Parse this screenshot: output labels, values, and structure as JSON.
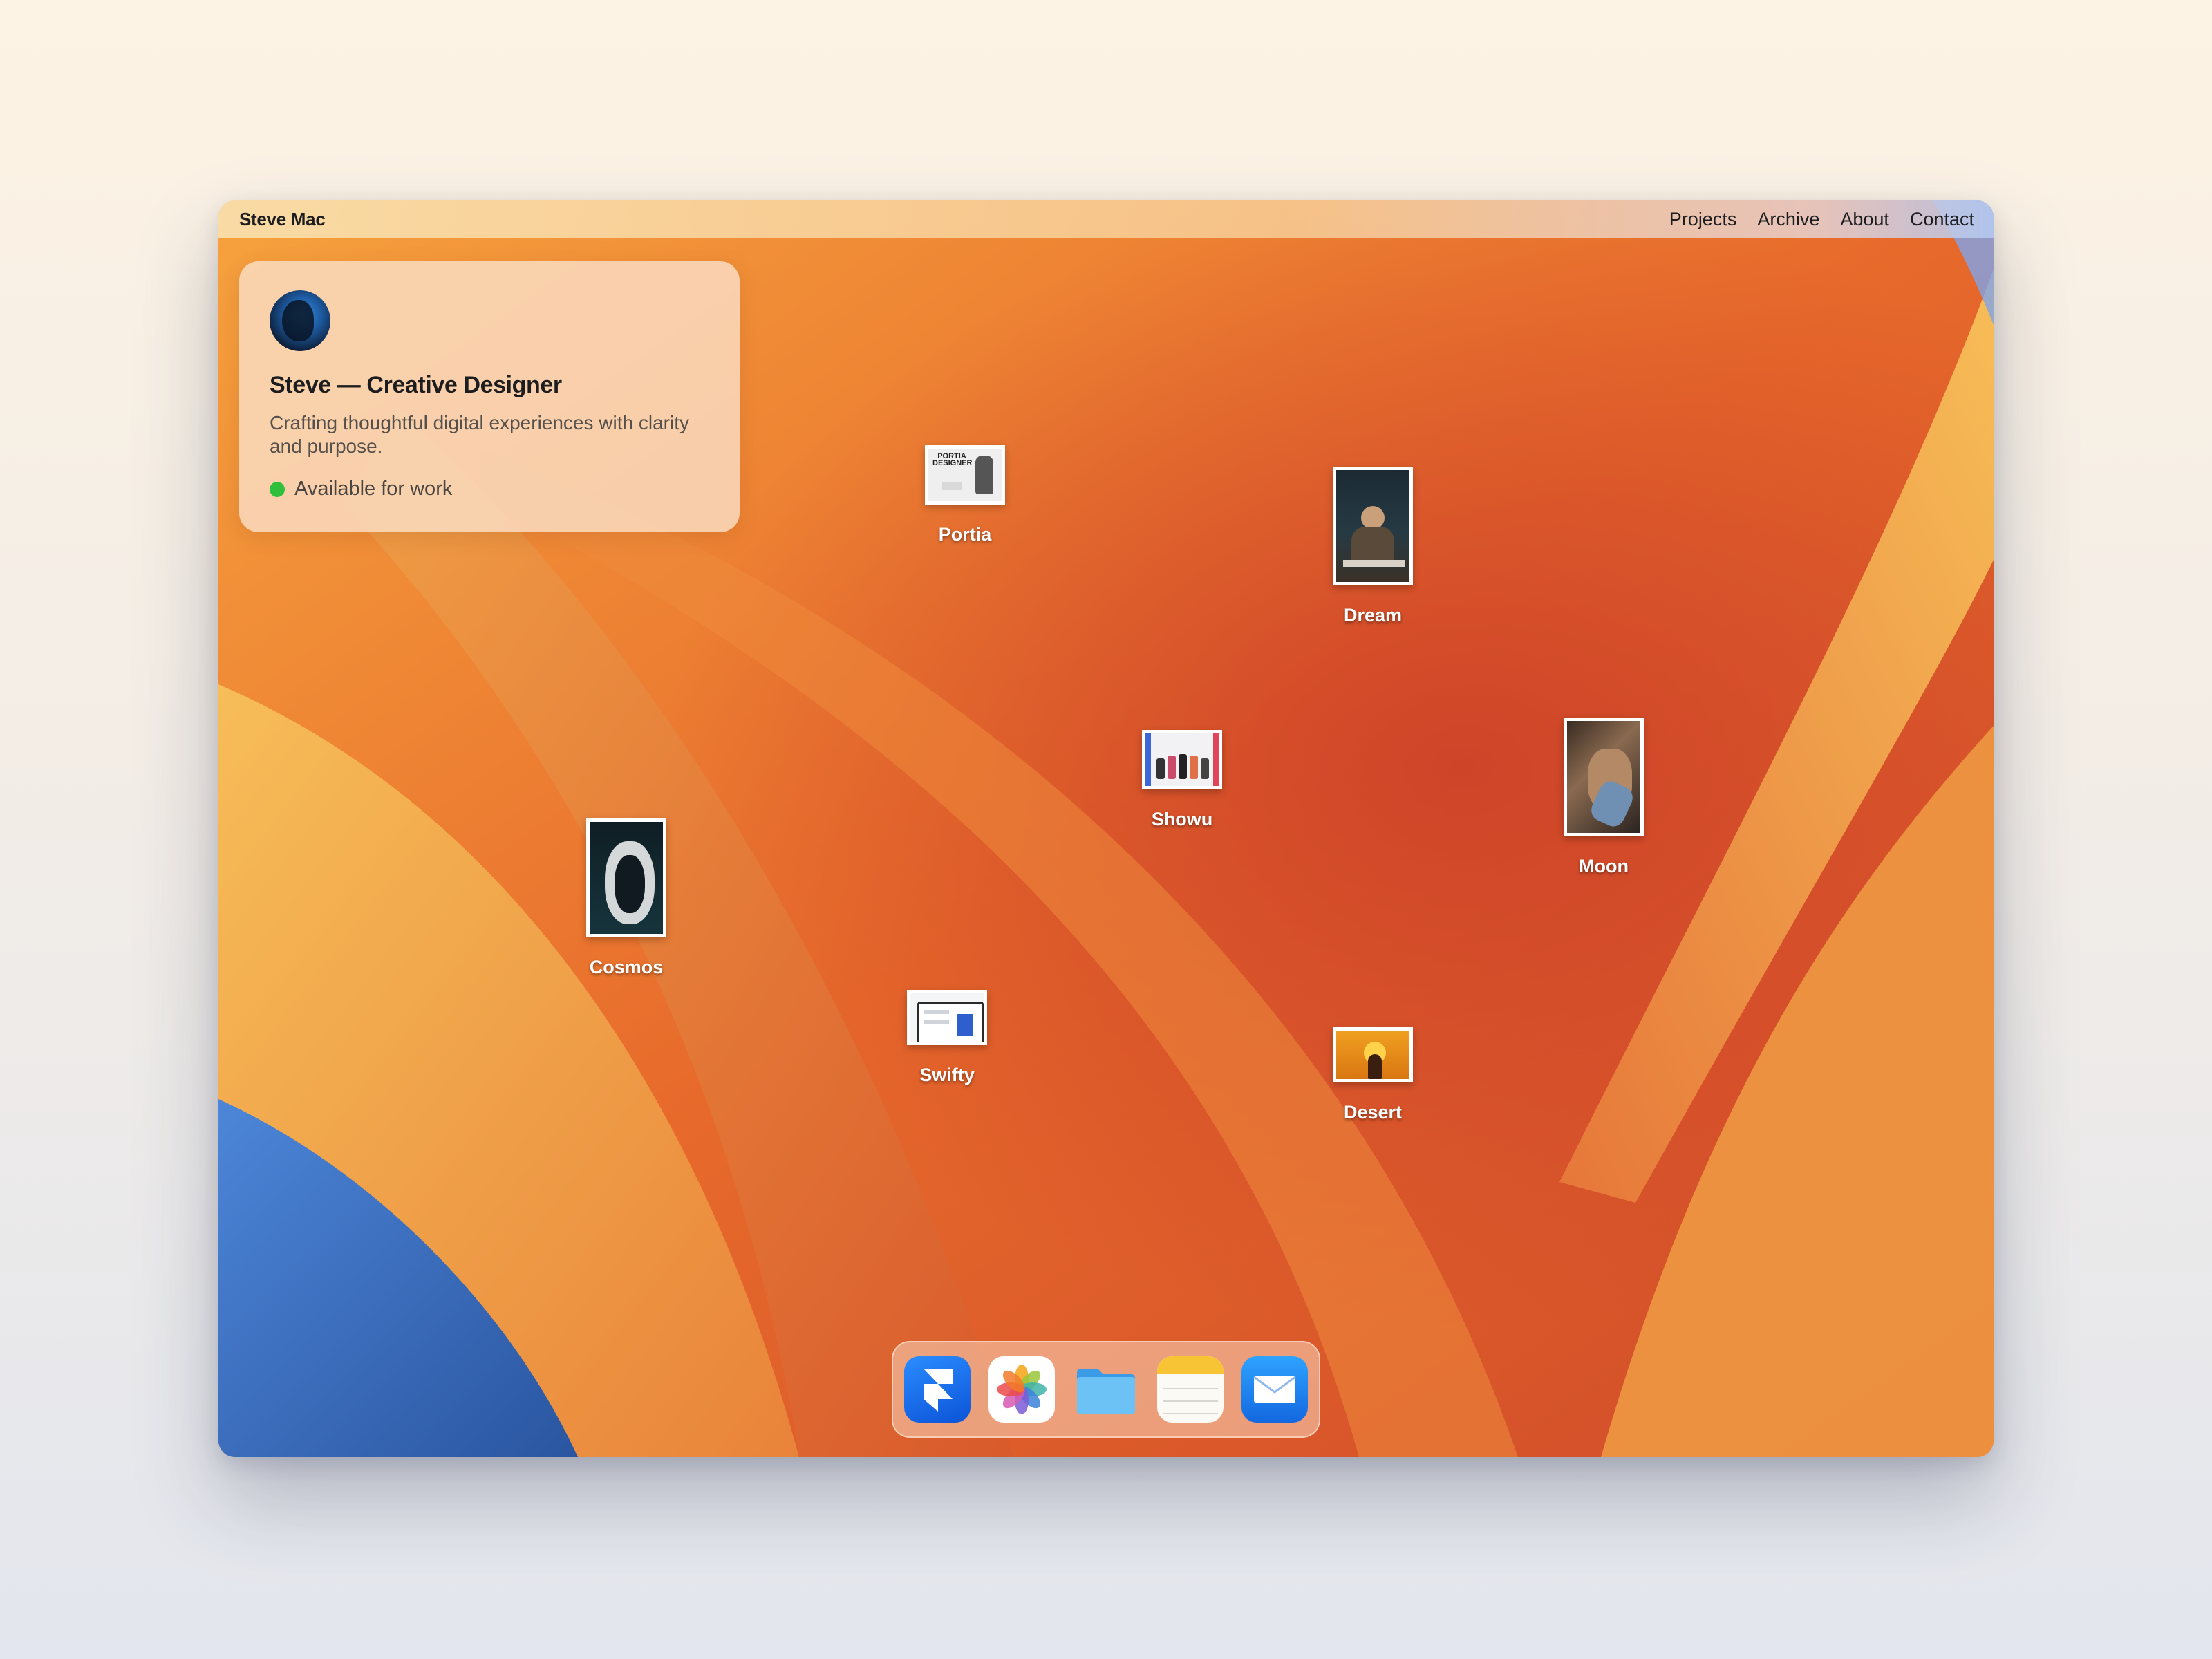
{
  "site": {
    "brand": "Steve Mac"
  },
  "nav": {
    "items": [
      "Projects",
      "Archive",
      "About",
      "Contact"
    ]
  },
  "profile": {
    "title": "Steve — Creative Designer",
    "description": "Crafting thoughtful digital experiences with clarity and purpose.",
    "status": "Available for work",
    "status_color": "#2fbf3b"
  },
  "desktop_items": [
    {
      "label": "Portia",
      "thumb_text": "PORTIA DESIGNER"
    },
    {
      "label": "Dream"
    },
    {
      "label": "Showu"
    },
    {
      "label": "Moon"
    },
    {
      "label": "Cosmos"
    },
    {
      "label": "Swifty"
    },
    {
      "label": "Desert"
    }
  ],
  "dock": {
    "apps": [
      "framer-icon",
      "photos-icon",
      "files-icon",
      "notes-icon",
      "mail-icon"
    ]
  },
  "colors": {
    "wallpaper_primary": "#e8662a",
    "wallpaper_highlight": "#f5b24a",
    "wallpaper_blue": "#3f6fc0"
  }
}
